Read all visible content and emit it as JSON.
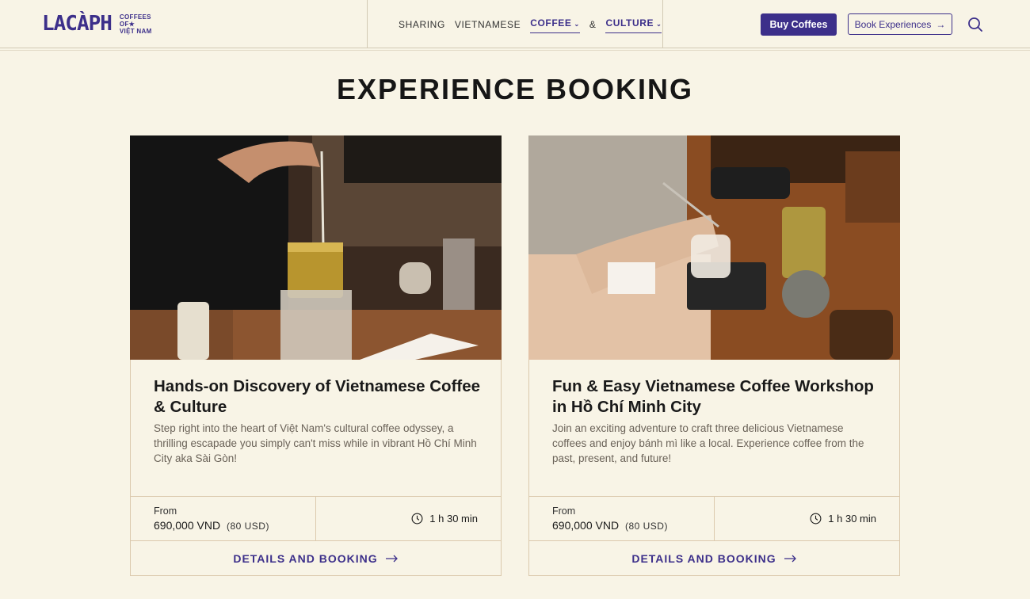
{
  "header": {
    "logo_text": "LACÀPH",
    "logo_sub": [
      "COFFEES",
      "OF★",
      "VIỆT NAM"
    ],
    "nav": [
      {
        "label": "SHARING",
        "active": false
      },
      {
        "label": "VIETNAMESE",
        "active": false
      },
      {
        "label": "COFFEE",
        "active": true,
        "dropdown": true
      },
      {
        "label": "&",
        "active": false
      },
      {
        "label": "CULTURE",
        "active": true,
        "dropdown": true
      }
    ],
    "buy_label": "Buy Coffees",
    "book_label": "Book Experiences"
  },
  "page": {
    "title": "EXPERIENCE BOOKING"
  },
  "cards": [
    {
      "title": "Hands-on Discovery of Vietnamese Coffee & Culture",
      "description": "Step right into the heart of Việt Nam's cultural coffee odyssey, a thrilling escapade you simply can't miss while in vibrant Hồ Chí Minh City aka Sài Gòn!",
      "from_label": "From",
      "price": "690,000 VND",
      "price_usd": "(80 USD)",
      "duration": "1 h 30 min",
      "cta": "DETAILS AND BOOKING"
    },
    {
      "title": "Fun & Easy Vietnamese Coffee Workshop in Hồ Chí Minh City",
      "description": "Join an exciting adventure to craft three delicious Vietnamese coffees and enjoy bánh mì like a local. Experience coffee from the past, present, and future!",
      "from_label": "From",
      "price": "690,000 VND",
      "price_usd": "(80 USD)",
      "duration": "1 h 30 min",
      "cta": "DETAILS AND BOOKING"
    }
  ],
  "colors": {
    "brand": "#3c2f8a",
    "background": "#f8f4e6",
    "border": "#dbc9ad"
  }
}
